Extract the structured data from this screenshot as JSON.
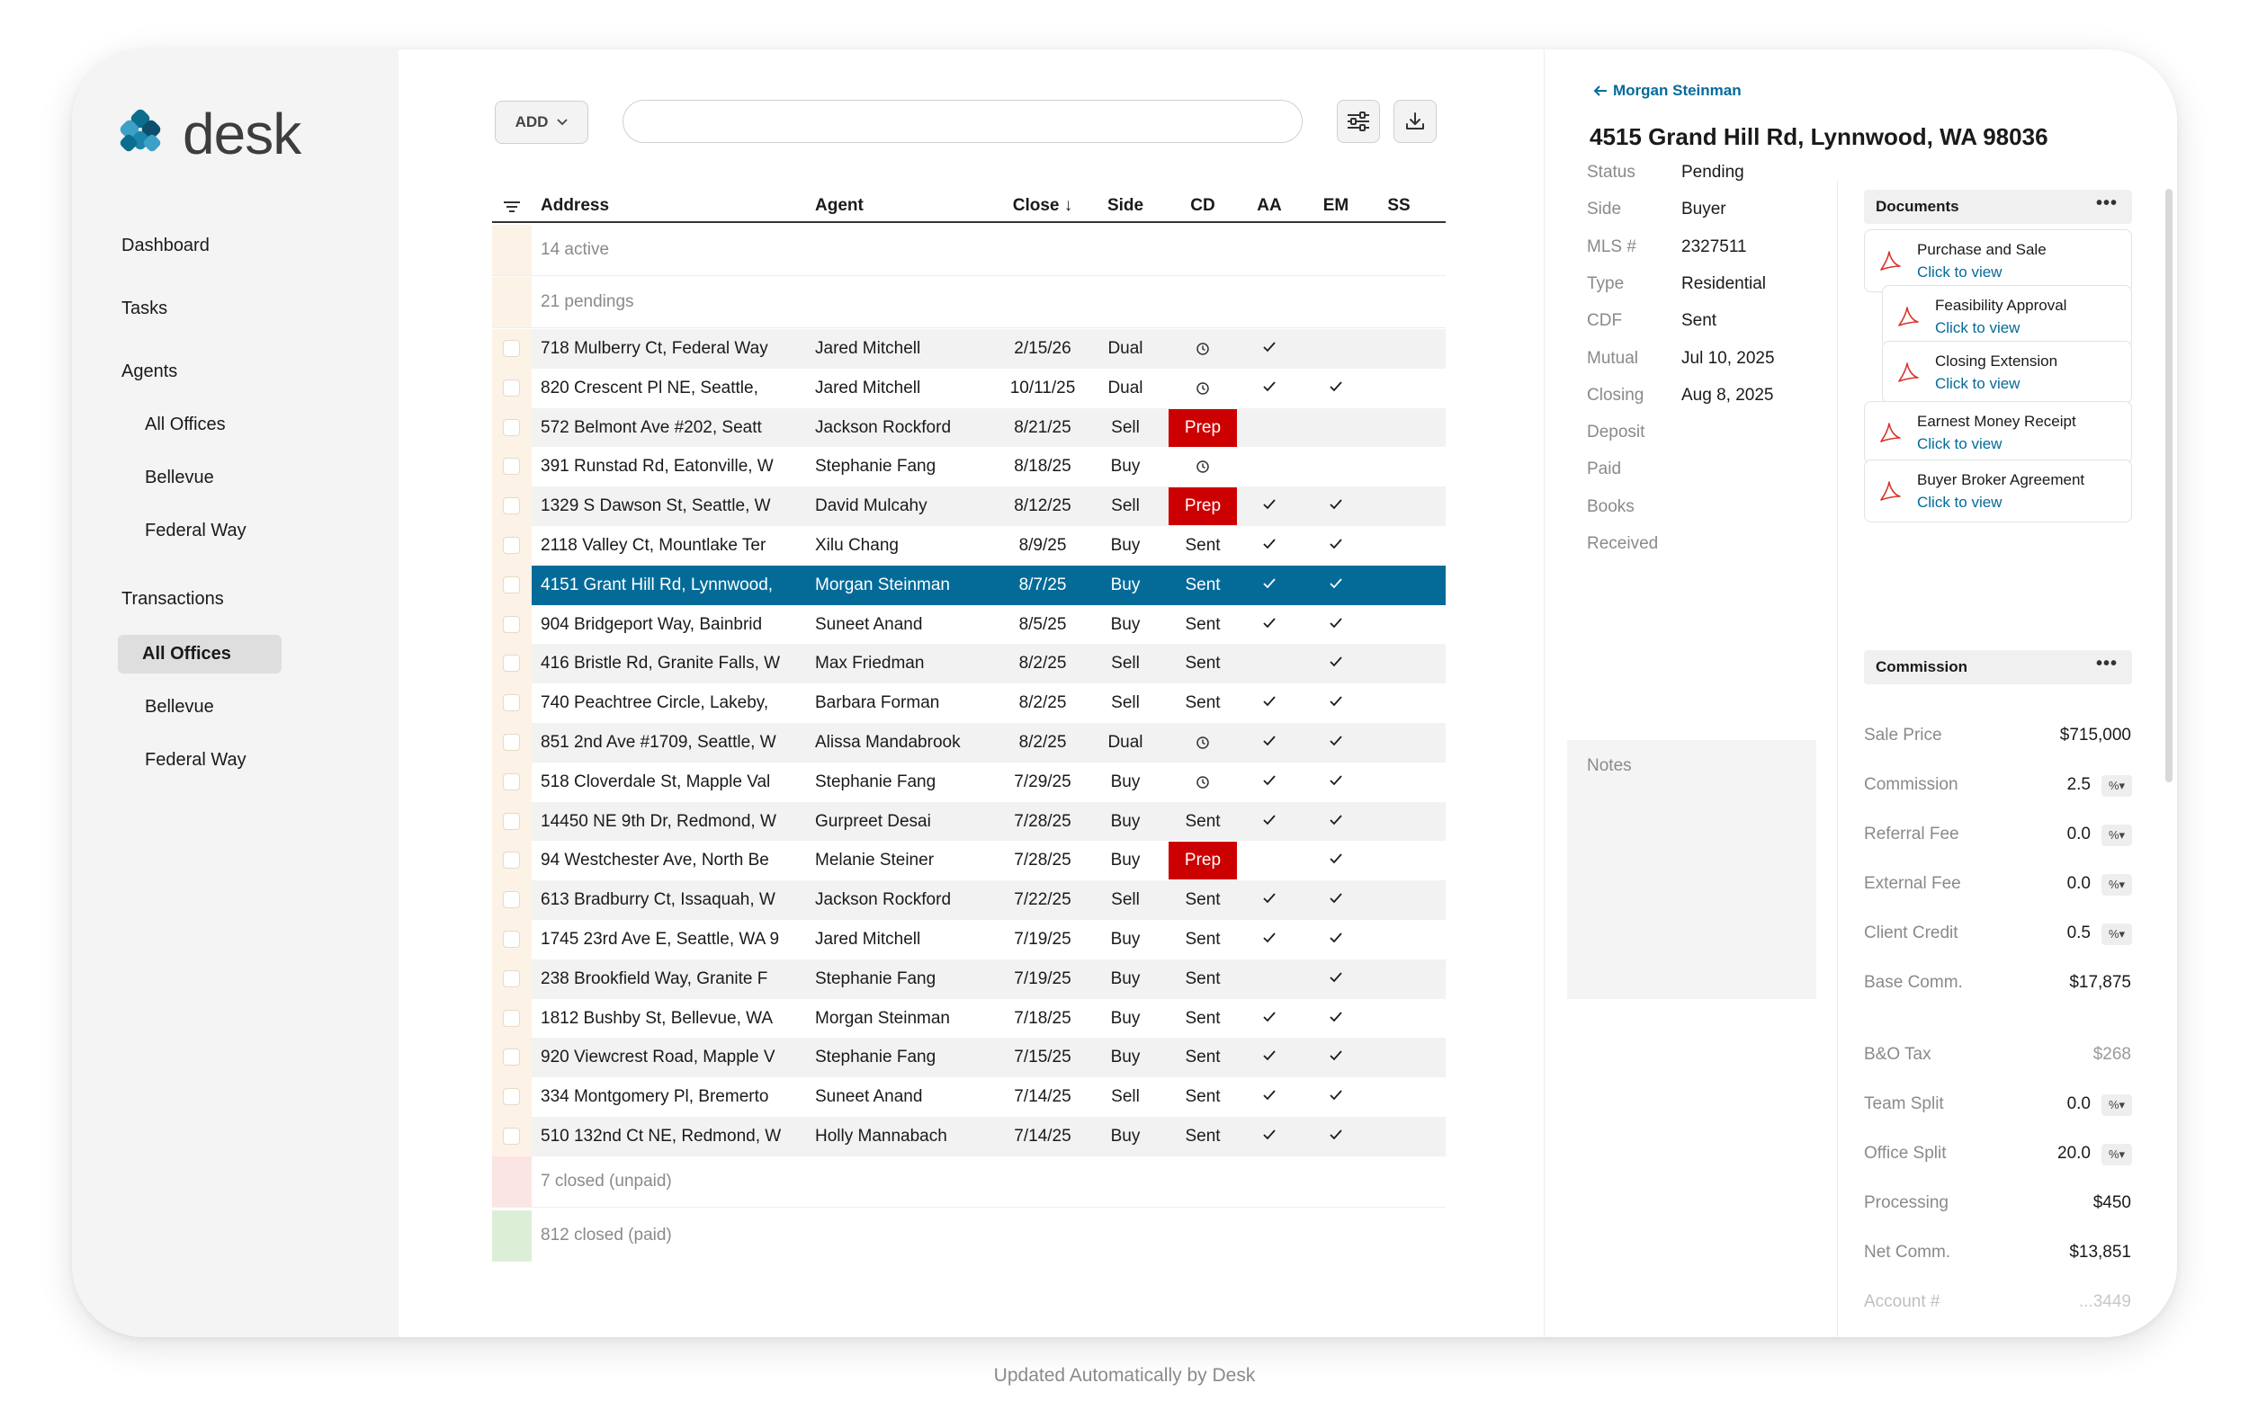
{
  "logo": {
    "text": "desk"
  },
  "nav": {
    "dashboard": "Dashboard",
    "tasks": "Tasks",
    "agents": "Agents",
    "agents_sub": [
      "All Offices",
      "Bellevue",
      "Federal Way"
    ],
    "transactions": "Transactions",
    "transactions_sub": [
      "All Offices",
      "Bellevue",
      "Federal Way"
    ]
  },
  "toolbar": {
    "add_label": "ADD",
    "search_placeholder": ""
  },
  "table": {
    "headers": {
      "address": "Address",
      "agent": "Agent",
      "close": "Close ↓",
      "side": "Side",
      "cd": "CD",
      "aa": "AA",
      "em": "EM",
      "ss": "SS"
    },
    "groups": {
      "active": "14 active",
      "pendings": "21 pendings",
      "closed_unpaid": "7 closed (unpaid)",
      "closed_paid": "812 closed (paid)"
    },
    "rows": [
      {
        "address": "718 Mulberry Ct, Federal Way",
        "agent": "Jared Mitchell",
        "close": "2/15/26",
        "side": "Dual",
        "cd": "clock",
        "aa": true,
        "em": false
      },
      {
        "address": "820 Crescent Pl NE, Seattle,",
        "agent": "Jared Mitchell",
        "close": "10/11/25",
        "side": "Dual",
        "cd": "clock",
        "aa": true,
        "em": true
      },
      {
        "address": "572 Belmont Ave #202, Seatt",
        "agent": "Jackson Rockford",
        "close": "8/21/25",
        "side": "Sell",
        "cd": "Prep",
        "aa": false,
        "em": false
      },
      {
        "address": "391 Runstad Rd, Eatonville, W",
        "agent": "Stephanie Fang",
        "close": "8/18/25",
        "side": "Buy",
        "cd": "clock",
        "aa": false,
        "em": false
      },
      {
        "address": "1329 S Dawson St, Seattle, W",
        "agent": "David Mulcahy",
        "close": "8/12/25",
        "side": "Sell",
        "cd": "Prep",
        "aa": true,
        "em": true
      },
      {
        "address": "2118 Valley Ct, Mountlake Ter",
        "agent": "Xilu Chang",
        "close": "8/9/25",
        "side": "Buy",
        "cd": "Sent",
        "aa": true,
        "em": true
      },
      {
        "address": "4151 Grant Hill Rd, Lynnwood,",
        "agent": "Morgan Steinman",
        "close": "8/7/25",
        "side": "Buy",
        "cd": "Sent",
        "aa": true,
        "em": true,
        "selected": true
      },
      {
        "address": "904 Bridgeport Way, Bainbrid",
        "agent": "Suneet Anand",
        "close": "8/5/25",
        "side": "Buy",
        "cd": "Sent",
        "aa": true,
        "em": true
      },
      {
        "address": "416 Bristle Rd, Granite Falls, W",
        "agent": "Max Friedman",
        "close": "8/2/25",
        "side": "Sell",
        "cd": "Sent",
        "aa": false,
        "em": true
      },
      {
        "address": "740 Peachtree Circle, Lakeby,",
        "agent": "Barbara Forman",
        "close": "8/2/25",
        "side": "Sell",
        "cd": "Sent",
        "aa": true,
        "em": true
      },
      {
        "address": "851 2nd Ave #1709, Seattle, W",
        "agent": "Alissa Mandabrook",
        "close": "8/2/25",
        "side": "Dual",
        "cd": "clock",
        "aa": true,
        "em": true
      },
      {
        "address": "518 Cloverdale St, Mapple Val",
        "agent": "Stephanie Fang",
        "close": "7/29/25",
        "side": "Buy",
        "cd": "clock",
        "aa": true,
        "em": true
      },
      {
        "address": "14450 NE 9th Dr, Redmond, W",
        "agent": "Gurpreet Desai",
        "close": "7/28/25",
        "side": "Buy",
        "cd": "Sent",
        "aa": true,
        "em": true
      },
      {
        "address": "94 Westchester Ave, North Be",
        "agent": "Melanie Steiner",
        "close": "7/28/25",
        "side": "Buy",
        "cd": "Prep",
        "aa": false,
        "em": true
      },
      {
        "address": "613 Bradburry Ct, Issaquah, W",
        "agent": "Jackson Rockford",
        "close": "7/22/25",
        "side": "Sell",
        "cd": "Sent",
        "aa": true,
        "em": true
      },
      {
        "address": "1745 23rd Ave E, Seattle, WA 9",
        "agent": "Jared Mitchell",
        "close": "7/19/25",
        "side": "Buy",
        "cd": "Sent",
        "aa": true,
        "em": true
      },
      {
        "address": "238 Brookfield Way, Granite F",
        "agent": "Stephanie Fang",
        "close": "7/19/25",
        "side": "Buy",
        "cd": "Sent",
        "aa": false,
        "em": true
      },
      {
        "address": "1812 Bushby St, Bellevue, WA",
        "agent": "Morgan Steinman",
        "close": "7/18/25",
        "side": "Buy",
        "cd": "Sent",
        "aa": true,
        "em": true
      },
      {
        "address": "920 Viewcrest Road, Mapple V",
        "agent": "Stephanie Fang",
        "close": "7/15/25",
        "side": "Buy",
        "cd": "Sent",
        "aa": true,
        "em": true
      },
      {
        "address": "334 Montgomery Pl, Bremerto",
        "agent": "Suneet Anand",
        "close": "7/14/25",
        "side": "Sell",
        "cd": "Sent",
        "aa": true,
        "em": true
      },
      {
        "address": "510 132nd Ct NE, Redmond, W",
        "agent": "Holly Mannabach",
        "close": "7/14/25",
        "side": "Buy",
        "cd": "Sent",
        "aa": true,
        "em": true
      }
    ]
  },
  "detail": {
    "back_label": "Morgan Steinman",
    "title": "4515 Grand Hill Rd, Lynnwood, WA 98036",
    "fields": [
      {
        "label": "Status",
        "value": "Pending"
      },
      {
        "label": "Side",
        "value": "Buyer"
      },
      {
        "label": "MLS #",
        "value": "2327511"
      },
      {
        "label": "Type",
        "value": "Residential"
      },
      {
        "label": "CDF",
        "value": "Sent"
      },
      {
        "label": "Mutual",
        "value": "Jul 10, 2025"
      },
      {
        "label": "Closing",
        "value": "Aug 8, 2025"
      },
      {
        "label": "Deposit",
        "value": ""
      },
      {
        "label": "Paid",
        "value": ""
      },
      {
        "label": "Books",
        "value": ""
      },
      {
        "label": "Received",
        "value": ""
      }
    ],
    "notes_label": "Notes",
    "documents": {
      "title": "Documents",
      "more": "•••",
      "items": [
        {
          "name": "Purchase and Sale",
          "link": "Click to view"
        },
        {
          "name": "Feasibility Approval",
          "link": "Click to view"
        },
        {
          "name": "Closing Extension",
          "link": "Click to view"
        },
        {
          "name": "Earnest Money Receipt",
          "link": "Click to view"
        },
        {
          "name": "Buyer Broker Agreement",
          "link": "Click to view"
        }
      ]
    },
    "commission": {
      "title": "Commission",
      "more": "•••",
      "pct_label": "%▾",
      "rows": [
        {
          "label": "Sale Price",
          "value": "$715,000"
        },
        {
          "label": "Commission",
          "value": "2.5"
        },
        {
          "label": "Referral Fee",
          "value": "0.0"
        },
        {
          "label": "External Fee",
          "value": "0.0"
        },
        {
          "label": "Client Credit",
          "value": "0.5"
        },
        {
          "label": "Base Comm.",
          "value": "$17,875"
        },
        {
          "label": "B&O Tax",
          "value": "$268"
        },
        {
          "label": "Team Split",
          "value": "0.0"
        },
        {
          "label": "Office Split",
          "value": "20.0"
        },
        {
          "label": "Processing",
          "value": "$450"
        },
        {
          "label": "Net Comm.",
          "value": "$13,851"
        },
        {
          "label": "Account #",
          "value": "...3449"
        }
      ]
    }
  },
  "footer": {
    "text": "Updated Automatically by Desk"
  },
  "colors": {
    "accent": "#046b99",
    "prep": "#cc0000",
    "selected_row": "#046b99",
    "pending_stripe": "#fdf2e6",
    "unpaid_stripe": "#fbe4e4",
    "paid_stripe": "#dcefd6"
  }
}
